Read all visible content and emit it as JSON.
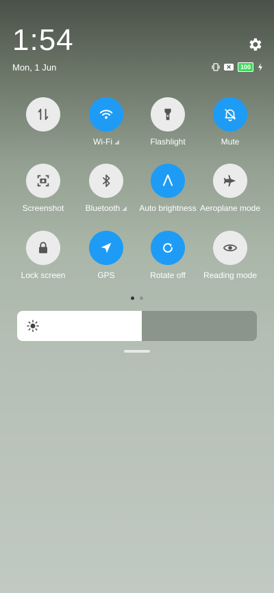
{
  "header": {
    "time": "1:54",
    "date": "Mon, 1 Jun",
    "battery_level": "100"
  },
  "tiles": [
    {
      "label": "Mobile data",
      "state": "off",
      "icon": "mobile-data-icon"
    },
    {
      "label": "Wi-Fi",
      "state": "on",
      "icon": "wifi-icon"
    },
    {
      "label": "Flashlight",
      "state": "off",
      "icon": "flashlight-icon"
    },
    {
      "label": "Mute",
      "state": "on",
      "icon": "mute-bell-icon"
    },
    {
      "label": "Screenshot",
      "state": "off",
      "icon": "screenshot-icon"
    },
    {
      "label": "Bluetooth",
      "state": "off",
      "icon": "bluetooth-icon"
    },
    {
      "label": "Auto brightness",
      "state": "on",
      "icon": "auto-brightness-icon"
    },
    {
      "label": "Aeroplane mode",
      "state": "off",
      "icon": "airplane-icon"
    },
    {
      "label": "Lock screen",
      "state": "off",
      "icon": "lock-icon"
    },
    {
      "label": "GPS",
      "state": "on",
      "icon": "gps-arrow-icon"
    },
    {
      "label": "Rotate off",
      "state": "on",
      "icon": "rotate-icon"
    },
    {
      "label": "Reading mode",
      "state": "off",
      "icon": "eye-icon"
    }
  ],
  "brightness": {
    "level_percent": 52
  },
  "pager": {
    "pages": 2,
    "current": 1
  },
  "colors": {
    "accent": "#1e9cf5",
    "tile_off": "#ebebeb",
    "icon_off": "#555555"
  }
}
